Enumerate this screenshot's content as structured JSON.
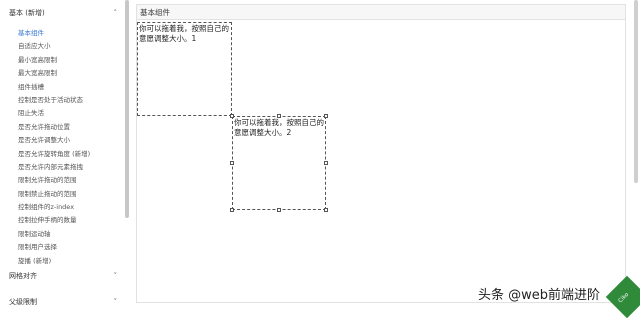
{
  "sidebar": {
    "group_basic": {
      "label": "基本 (新增)",
      "icon": "chevron-up-icon"
    },
    "items": [
      {
        "label": "基本组件",
        "active": true
      },
      {
        "label": "自适应大小"
      },
      {
        "label": "最小宽高限制"
      },
      {
        "label": "最大宽高限制"
      },
      {
        "label": "组件插槽"
      },
      {
        "label": "控制是否处于活动状态"
      },
      {
        "label": "阻止失活"
      },
      {
        "label": "是否允许拖动位置"
      },
      {
        "label": "是否允许调整大小"
      },
      {
        "label": "是否允许旋转角度 (新增)"
      },
      {
        "label": "是否允许内部元素拖拽"
      },
      {
        "label": "限制允许拖动的范围"
      },
      {
        "label": "限制禁止拖动的范围"
      },
      {
        "label": "控制组件的z-index"
      },
      {
        "label": "控制拉伸手柄的数量"
      },
      {
        "label": "限制运动轴"
      },
      {
        "label": "限制用户选择"
      },
      {
        "label": "旋播 (新增)"
      }
    ],
    "group_grid": {
      "label": "网格对齐",
      "icon": "chevron-down-icon"
    },
    "group_parent": {
      "label": "父级限制",
      "icon": "chevron-down-icon"
    }
  },
  "main": {
    "title": "基本组件",
    "box1": {
      "text": "你可以拖着我，按照自己的意愿调整大小。1"
    },
    "box2": {
      "text": "你可以拖着我，按照自己的意愿调整大小。2"
    }
  },
  "watermark": {
    "text": "头条 @web前端进阶"
  },
  "badge": {
    "text": "Ciko"
  },
  "colors": {
    "accent": "#3a7bd5",
    "badge": "#2f8a3a"
  }
}
